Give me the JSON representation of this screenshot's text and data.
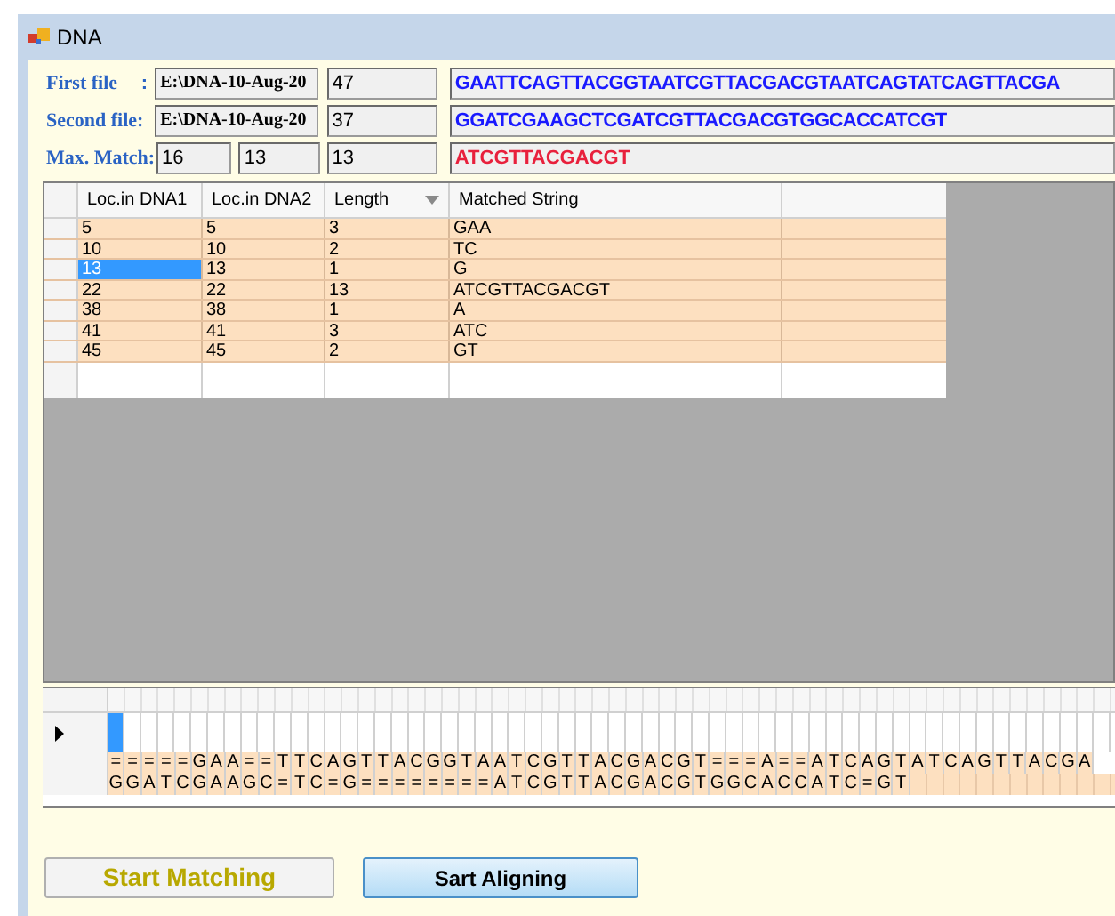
{
  "window": {
    "title": "DNA"
  },
  "files": [
    {
      "label": "First file",
      "separator": ":",
      "path": "E:\\DNA-10-Aug-20",
      "length": "47",
      "sequence": "GAATTCAGTTACGGTAATCGTTACGACGTAATCAGTATCAGTTACGA"
    },
    {
      "label": "Second file:",
      "path": "E:\\DNA-10-Aug-20",
      "length": "37",
      "sequence": "GGATCGAAGCTCGATCGTTACGACGTGGCACCATCGT"
    }
  ],
  "max_match": {
    "label": "Max. Match:",
    "values": [
      "16",
      "13",
      "13"
    ],
    "sequence": "ATCGTTACGACGT"
  },
  "table": {
    "columns": [
      {
        "label": "Loc.in DNA1",
        "sorted": false
      },
      {
        "label": "Loc.in DNA2",
        "sorted": false
      },
      {
        "label": "Length",
        "sorted": true
      },
      {
        "label": "Matched String",
        "sorted": false
      }
    ],
    "rows": [
      {
        "cells": [
          "5",
          "5",
          "3",
          "GAA"
        ],
        "selected": false
      },
      {
        "cells": [
          "10",
          "10",
          "2",
          "TC"
        ],
        "selected": false
      },
      {
        "cells": [
          "13",
          "13",
          "1",
          "G"
        ],
        "selected": true
      },
      {
        "cells": [
          "22",
          "22",
          "13",
          "ATCGTTACGACGT"
        ],
        "selected": false
      },
      {
        "cells": [
          "38",
          "38",
          "1",
          "A"
        ],
        "selected": false
      },
      {
        "cells": [
          "41",
          "41",
          "3",
          "ATC"
        ],
        "selected": false
      },
      {
        "cells": [
          "45",
          "45",
          "2",
          "GT"
        ],
        "selected": false
      }
    ]
  },
  "alignment": {
    "rows": [
      {
        "current": true
      },
      {
        "cells": [
          "=",
          "=",
          "=",
          "=",
          "=",
          "G",
          "A",
          "A",
          "=",
          "=",
          "T",
          "T",
          "C",
          "A",
          "G",
          "T",
          "T",
          "A",
          "C",
          "G",
          "G",
          "T",
          "A",
          "A",
          "T",
          "C",
          "G",
          "T",
          "T",
          "A",
          "C",
          "G",
          "A",
          "C",
          "G",
          "T",
          "=",
          "=",
          "=",
          "A",
          "=",
          "=",
          "A",
          "T",
          "C",
          "A",
          "G",
          "T",
          "A",
          "T",
          "C",
          "A",
          "G",
          "T",
          "T",
          "A",
          "C",
          "G",
          "A"
        ],
        "current": false
      },
      {
        "cells": [
          "G",
          "G",
          "A",
          "T",
          "C",
          "G",
          "A",
          "A",
          "G",
          "C",
          "=",
          "T",
          "C",
          "=",
          "G",
          "=",
          "=",
          "=",
          "=",
          "=",
          "=",
          "=",
          "=",
          "A",
          "T",
          "C",
          "G",
          "T",
          "T",
          "A",
          "C",
          "G",
          "A",
          "C",
          "G",
          "T",
          "G",
          "G",
          "C",
          "A",
          "C",
          "C",
          "A",
          "T",
          "C",
          "=",
          "G",
          "T"
        ],
        "current": false
      }
    ]
  },
  "buttons": [
    {
      "label": "Start Matching",
      "kind": "plain"
    },
    {
      "label": "Sart Aligning",
      "kind": "blue"
    }
  ]
}
